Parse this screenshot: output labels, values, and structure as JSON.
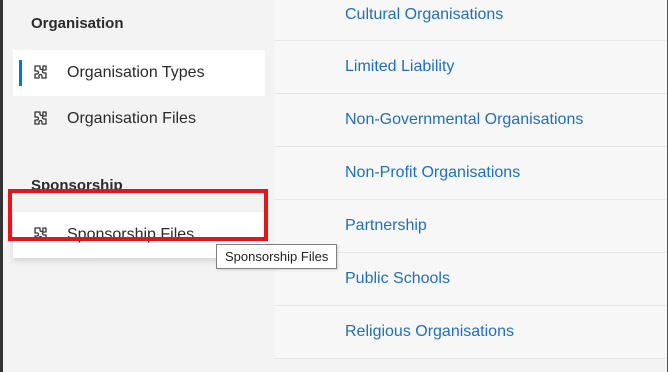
{
  "sidebar": {
    "sections": [
      {
        "heading": "Organisation",
        "items": [
          {
            "label": "Organisation Types",
            "icon": "puzzle-icon",
            "active": true
          },
          {
            "label": "Organisation Files",
            "icon": "puzzle-icon"
          }
        ]
      },
      {
        "heading": "Sponsorship",
        "items": [
          {
            "label": "Sponsorship Files",
            "icon": "puzzle-icon",
            "hovered": true
          }
        ]
      }
    ]
  },
  "content": {
    "items": [
      "Cultural Organisations",
      "Limited Liability",
      "Non-Governmental Organisations",
      "Non-Profit Organisations",
      "Partnership",
      "Public Schools",
      "Religious Organisations"
    ]
  },
  "tooltip": {
    "text": "Sponsorship Files"
  },
  "colors": {
    "accent": "#0078d4",
    "link": "#1f6fc1",
    "highlight": "#e5131a"
  }
}
